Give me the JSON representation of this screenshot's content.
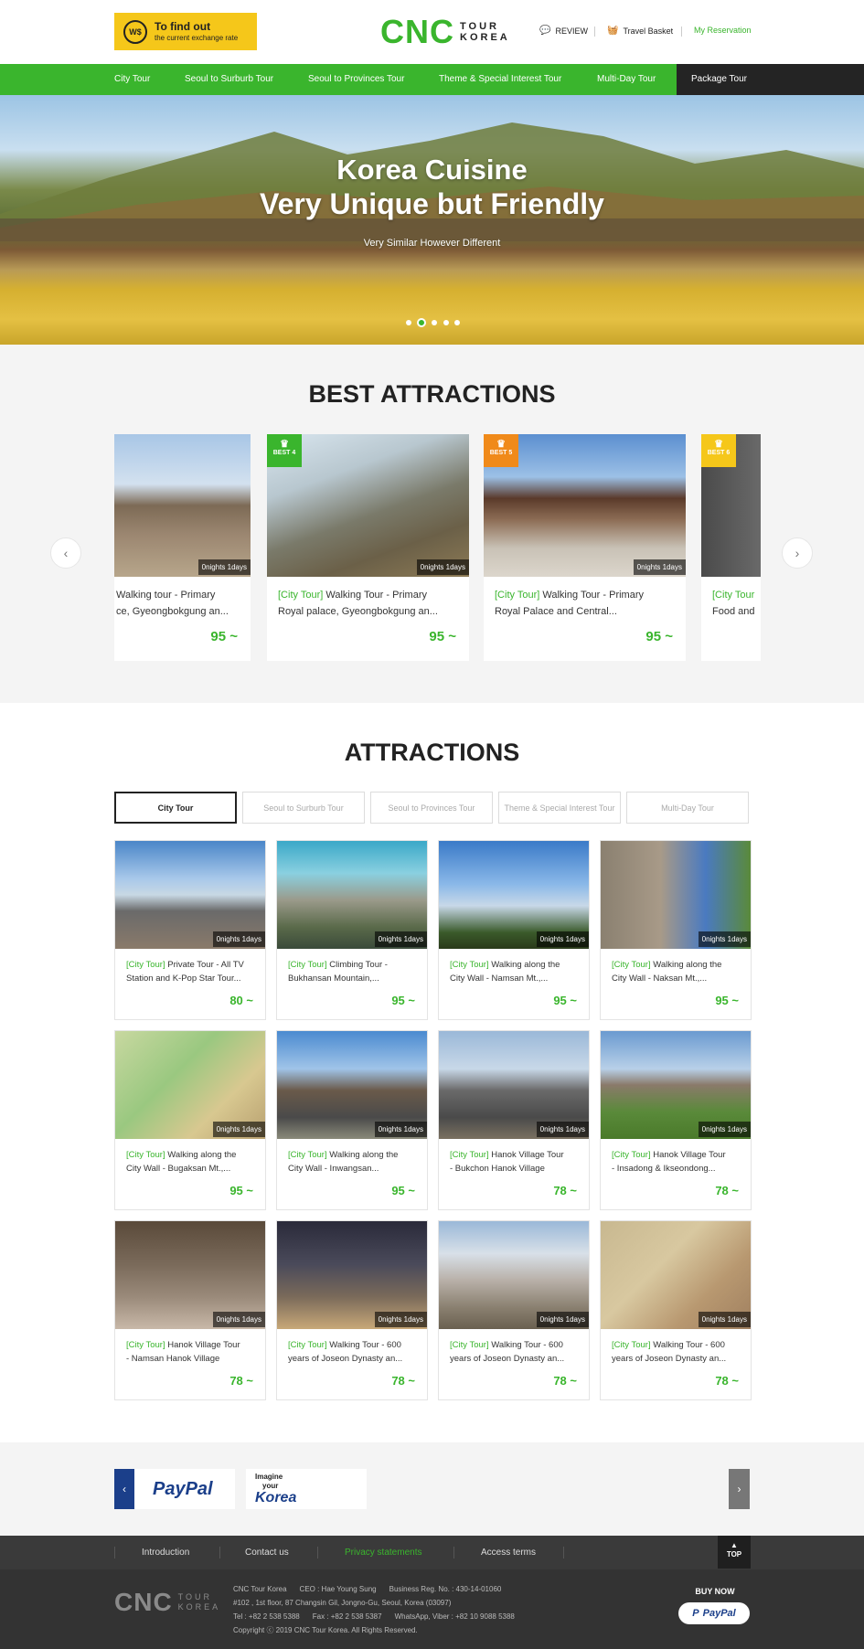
{
  "header": {
    "exchange_title": "To find out",
    "exchange_sub": "the current exchange rate",
    "coin_glyph": "W$",
    "logo_main": "CNC",
    "logo_line1": "TOUR",
    "logo_line2": "KOREA",
    "review": "REVIEW",
    "basket": "Travel Basket",
    "reservation": "My Reservation"
  },
  "nav": [
    "City Tour",
    "Seoul to Surburb Tour",
    "Seoul to Provinces Tour",
    "Theme & Special Interest Tour",
    "Multi-Day Tour",
    "Package Tour"
  ],
  "hero": {
    "title_line1": "Korea Cuisine",
    "title_line2": "Very Unique but Friendly",
    "subtitle": "Very Similar However Different",
    "slides": 5,
    "active_slide": 2
  },
  "best": {
    "heading": "BEST ATTRACTIONS",
    "cards": [
      {
        "badge": "",
        "days": "0nights 1days",
        "category": "",
        "title": "Walking tour - Primary",
        "title2": "ce, Gyeongbokgung an...",
        "price": "95 ~"
      },
      {
        "badge": "BEST 4",
        "days": "0nights 1days",
        "category": "[City Tour]",
        "title": " Walking Tour - Primary",
        "title2": "Royal palace, Gyeongbokgung an...",
        "price": "95 ~"
      },
      {
        "badge": "BEST 5",
        "days": "0nights 1days",
        "category": "[City Tour]",
        "title": " Walking Tour - Primary",
        "title2": "Royal Palace and Central...",
        "price": "95 ~"
      },
      {
        "badge": "BEST 6",
        "days": "",
        "category": "[City Tour",
        "title": "",
        "title2": "Food and",
        "price": ""
      }
    ]
  },
  "attractions": {
    "heading": "ATTRACTIONS",
    "tabs": [
      "City Tour",
      "Seoul to Surburb Tour",
      "Seoul to Provinces Tour",
      "Theme & Special Interest Tour",
      "Multi-Day Tour"
    ],
    "cards": [
      {
        "days": "0nights 1days",
        "category": "[City Tour]",
        "title": " Private Tour - All TV",
        "title2": "Station and K-Pop Star Tour...",
        "price": "80 ~"
      },
      {
        "days": "0nights 1days",
        "category": "[City Tour]",
        "title": " Climbing Tour -",
        "title2": "Bukhansan Mountain,...",
        "price": "95 ~"
      },
      {
        "days": "0nights 1days",
        "category": "[City Tour]",
        "title": " Walking along the",
        "title2": "City Wall - Namsan Mt.,...",
        "price": "95 ~"
      },
      {
        "days": "0nights 1days",
        "category": "[City Tour]",
        "title": " Walking along the",
        "title2": "City Wall - Naksan Mt.,...",
        "price": "95 ~"
      },
      {
        "days": "0nights 1days",
        "category": "[City Tour]",
        "title": " Walking along the",
        "title2": "City Wall - Bugaksan Mt.,...",
        "price": "95 ~"
      },
      {
        "days": "0nights 1days",
        "category": "[City Tour]",
        "title": " Walking along the",
        "title2": "City Wall - Inwangsan...",
        "price": "95 ~"
      },
      {
        "days": "0nights 1days",
        "category": "[City Tour]",
        "title": " Hanok Village Tour",
        "title2": "- Bukchon Hanok Village",
        "price": "78 ~"
      },
      {
        "days": "0nights 1days",
        "category": "[City Tour]",
        "title": " Hanok Village Tour",
        "title2": "- Insadong & Ikseondong...",
        "price": "78 ~"
      },
      {
        "days": "0nights 1days",
        "category": "[City Tour]",
        "title": " Hanok Village Tour",
        "title2": "- Namsan Hanok Village",
        "price": "78 ~"
      },
      {
        "days": "0nights 1days",
        "category": "[City Tour]",
        "title": " Walking Tour - 600",
        "title2": "years of Joseon Dynasty an...",
        "price": "78 ~"
      },
      {
        "days": "0nights 1days",
        "category": "[City Tour]",
        "title": " Walking Tour - 600",
        "title2": "years of Joseon Dynasty an...",
        "price": "78 ~"
      },
      {
        "days": "0nights 1days",
        "category": "[City Tour]",
        "title": " Walking Tour - 600",
        "title2": "years of Joseon Dynasty an...",
        "price": "78 ~"
      }
    ]
  },
  "partners": {
    "paypal": "PayPal",
    "imagine_line1": "Imagine",
    "imagine_line2": "your",
    "imagine_line3": "Korea"
  },
  "footer": {
    "links": [
      "Introduction",
      "Contact us",
      "Privacy statements",
      "Access terms"
    ],
    "top": "TOP",
    "logo_main": "CNC",
    "logo_line1": "TOUR",
    "logo_line2": "KOREA",
    "company": "CNC Tour Korea",
    "ceo": "CEO : Hae Young Sung",
    "reg": "Business Reg. No. : 430-14-01060",
    "address": "#102 , 1st floor, 87 Changsin Gil, Jongno-Gu, Seoul, Korea (03097)",
    "tel": "Tel : +82 2 538 5388",
    "fax": "Fax : +82 2 538 5387",
    "whatsapp": "WhatsApp, Viber : +82 10 9088 5388",
    "copyright": "Copyright ⓒ 2019 CNC Tour Korea. All Rights Reserved.",
    "buy_now": "BUY NOW",
    "paypal": "PayPal"
  },
  "colors": {
    "accent": "#3ab52d",
    "dark": "#242424",
    "footer": "#333333",
    "exchange": "#f5c71a"
  }
}
